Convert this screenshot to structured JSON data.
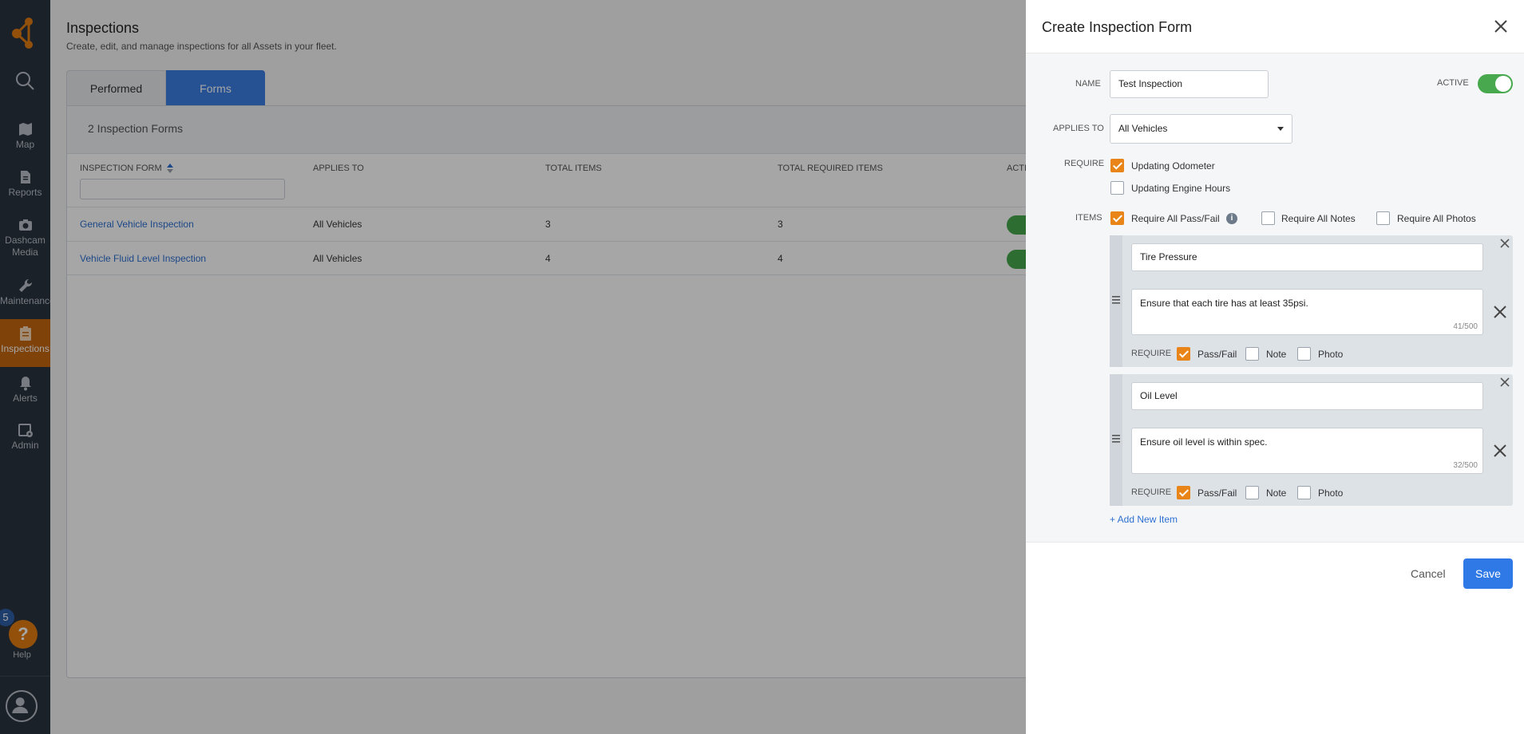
{
  "nav": {
    "items": [
      {
        "label": "Map",
        "icon": "map-icon"
      },
      {
        "label": "Reports",
        "icon": "reports-icon"
      },
      {
        "label": "Dashcam",
        "label2": "Media",
        "icon": "camera-icon"
      },
      {
        "label": "Maintenance",
        "icon": "wrench-icon"
      },
      {
        "label": "Inspections",
        "icon": "clipboard-icon"
      },
      {
        "label": "Alerts",
        "icon": "bell-icon"
      },
      {
        "label": "Admin",
        "icon": "admin-icon"
      }
    ],
    "help_label": "Help",
    "help_symbol": "?",
    "notification_count": "5"
  },
  "page": {
    "title": "Inspections",
    "subtitle": "Create, edit, and manage inspections for all Assets in your fleet.",
    "tabs": [
      "Performed",
      "Forms"
    ],
    "count_label": "2 Inspection Forms",
    "columns": [
      "INSPECTION FORM",
      "APPLIES TO",
      "TOTAL ITEMS",
      "TOTAL REQUIRED ITEMS",
      "ACTI"
    ],
    "rows": [
      {
        "name": "General Vehicle Inspection",
        "applies_to": "All Vehicles",
        "total": "3",
        "required": "3"
      },
      {
        "name": "Vehicle Fluid Level Inspection",
        "applies_to": "All Vehicles",
        "total": "4",
        "required": "4"
      }
    ]
  },
  "drawer": {
    "title": "Create Inspection Form",
    "name_label": "NAME",
    "name_value": "Test Inspection",
    "active_label": "ACTIVE",
    "active": true,
    "applies_label": "APPLIES TO",
    "applies_value": "All Vehicles",
    "require_label": "REQUIRE",
    "require_odometer": "Updating Odometer",
    "require_engine": "Updating Engine Hours",
    "items_label": "ITEMS",
    "all_pass_fail": "Require All Pass/Fail",
    "info_symbol": "i",
    "all_notes": "Require All Notes",
    "all_photos": "Require All Photos",
    "items": [
      {
        "name": "Tire Pressure",
        "description": "Ensure that each tire has at least 35psi.",
        "counter": "41/500",
        "require_label": "REQUIRE",
        "pass_fail": "Pass/Fail",
        "note": "Note",
        "photo": "Photo"
      },
      {
        "name": "Oil Level",
        "description": "Ensure oil level is within spec.",
        "counter": "32/500",
        "require_label": "REQUIRE",
        "pass_fail": "Pass/Fail",
        "note": "Note",
        "photo": "Photo"
      }
    ],
    "add_item": "+ Add New Item",
    "cancel": "Cancel",
    "save": "Save"
  },
  "colors": {
    "accent_orange": "#e07b12",
    "primary_blue": "#2f79e6",
    "toggle_green": "#47a84e",
    "nav_bg": "#2a3340"
  }
}
